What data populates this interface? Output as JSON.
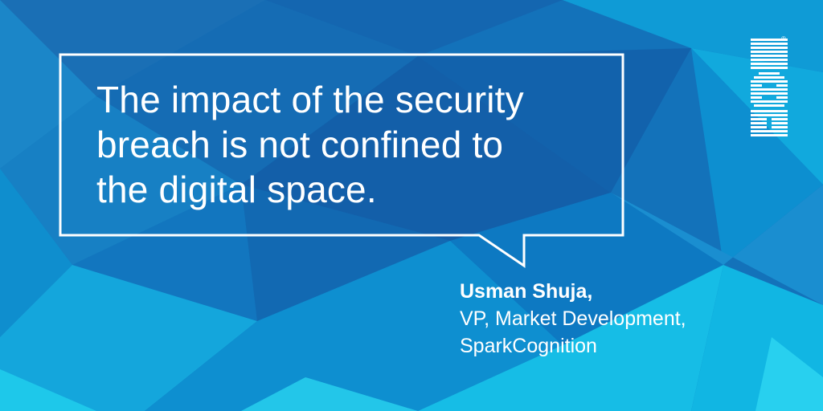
{
  "quote": {
    "lines": [
      "The impact of the security",
      "breach is not confined to",
      "the digital space."
    ]
  },
  "attribution": {
    "name": "Usman Shuja,",
    "title": "VP, Market Development,",
    "company": "SparkCognition"
  },
  "brand": {
    "logo": "IBM",
    "registered_mark": "®"
  },
  "colors": {
    "background": "#1478c0",
    "text": "#ffffff",
    "accent_cyan": "#14c2e6"
  }
}
